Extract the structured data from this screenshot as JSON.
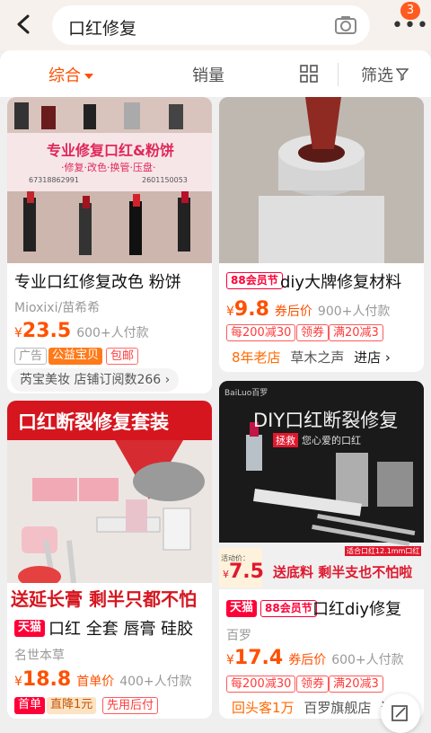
{
  "search": {
    "query": "口红修复"
  },
  "header": {
    "badge_count": "3"
  },
  "tabs": {
    "sort": "综合",
    "sales": "销量",
    "filter": "筛选"
  },
  "colors": {
    "accent": "#ff5000",
    "tmall": "#ff0036"
  },
  "products": [
    {
      "banner": "专业修复口红&粉饼",
      "banner_sub": "·修复·改色·换管·压盘·",
      "banner_contact": "67318862991",
      "banner_shop": "2601150053",
      "title": "专业口红修复改色 粉饼",
      "shop": "Mioxixi/苗希希",
      "price": "23.5",
      "sales": "600+人付款",
      "tags": [
        "广告",
        "公益宝贝",
        "包邮"
      ],
      "store_pill": "芮宝美妆 店铺订阅数266"
    },
    {
      "title": "diy大牌修复材料",
      "badge88": "88会员节",
      "price": "9.8",
      "price_note": "券后价",
      "sales": "900+人付款",
      "tags": [
        "每200减30",
        "领券",
        "满20减3"
      ],
      "store_line": "8年老店",
      "store_name": "草木之声",
      "store_link": "进店"
    },
    {
      "banner": "口红断裂修复套装",
      "bottom_banner": "送延长膏 剩半只都不怕",
      "tmall": "天猫",
      "title": "口红 全套 唇膏 硅胶",
      "shop": "名世本草",
      "price": "18.8",
      "price_note": "首单价",
      "sales": "400+人付款",
      "tags": [
        "首单",
        "直降1元",
        "先用后付"
      ]
    },
    {
      "brand": "BaiLuo百罗",
      "banner": "DIY口红断裂修复",
      "banner_red": "拯救",
      "banner_sub": "您心爱的口红",
      "size_note": "适合口红12.1mm口红",
      "promo_price_label": "活动价：",
      "promo_price": "7.5",
      "promo_text": "送底料 剩半支也不怕啦",
      "tmall": "天猫",
      "badge88": "88会员节",
      "title": "口红diy修复",
      "shop": "百罗",
      "price": "17.4",
      "price_note": "券后价",
      "sales": "600+人付款",
      "tags": [
        "每200减30",
        "领券",
        "满20减3"
      ],
      "store_line": "回头客1万",
      "store_name": "百罗旗舰店",
      "store_link": "进"
    }
  ]
}
